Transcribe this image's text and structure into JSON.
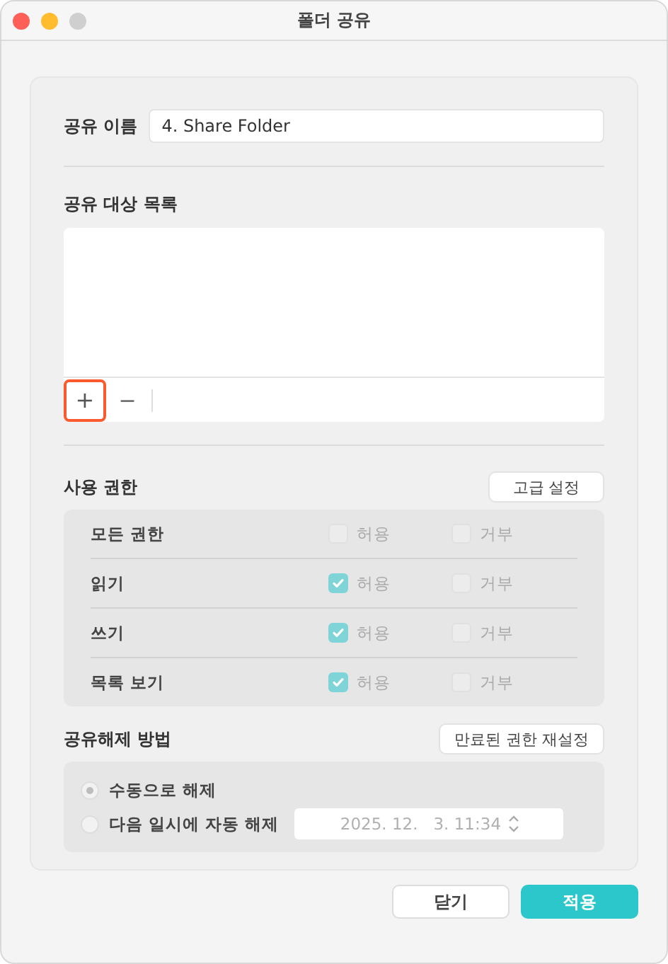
{
  "window": {
    "title": "폴더 공유"
  },
  "share_name": {
    "label": "공유 이름",
    "value": "4. Share Folder"
  },
  "targets": {
    "label": "공유 대상 목록",
    "buttons": [
      {
        "kind": "add",
        "label": "+",
        "highlighted": true
      },
      {
        "kind": "remove",
        "label": "−",
        "highlighted": false
      }
    ]
  },
  "permissions": {
    "label": "사용 권한",
    "advanced_button": "고급 설정",
    "rows": [
      {
        "name": "모든 권한",
        "allow": {
          "label": "허용",
          "checked": false
        },
        "deny": {
          "label": "거부",
          "checked": false
        }
      },
      {
        "name": "읽기",
        "allow": {
          "label": "허용",
          "checked": true
        },
        "deny": {
          "label": "거부",
          "checked": false
        }
      },
      {
        "name": "쓰기",
        "allow": {
          "label": "허용",
          "checked": true
        },
        "deny": {
          "label": "거부",
          "checked": false
        }
      },
      {
        "name": "목록 보기",
        "allow": {
          "label": "허용",
          "checked": true
        },
        "deny": {
          "label": "거부",
          "checked": false
        }
      }
    ]
  },
  "unshare": {
    "label": "공유해제 방법",
    "reset_button": "만료된 권한 재설정",
    "options": [
      {
        "label": "수동으로 해제",
        "selected": true
      },
      {
        "label": "다음 일시에 자동 해제",
        "selected": false,
        "datetime": "2025. 12.   3. 11:34"
      }
    ]
  },
  "buttons": [
    {
      "label": "닫기",
      "kind": "secondary"
    },
    {
      "label": "적용",
      "kind": "primary"
    }
  ]
}
